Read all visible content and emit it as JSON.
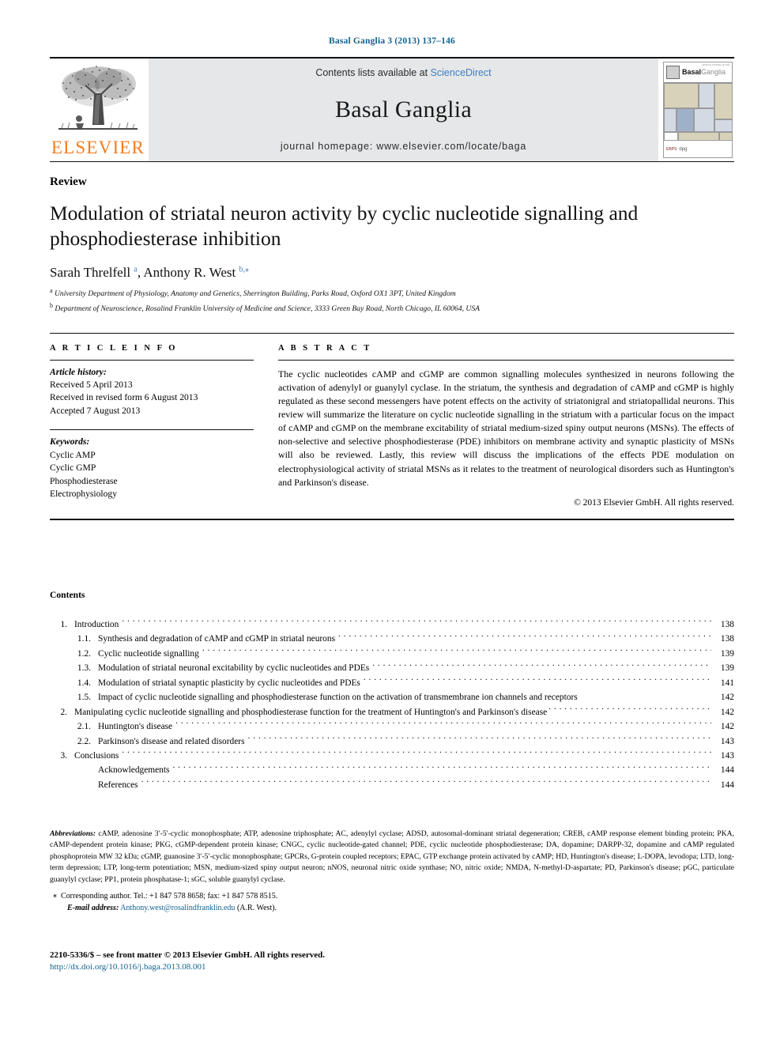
{
  "running_head": "Basal Ganglia 3 (2013) 137–146",
  "masthead": {
    "publisher_logo_word": "ELSEVIER",
    "contents_line_prefix": "Contents lists available at ",
    "sciencedirect": "ScienceDirect",
    "journal_name": "Basal Ganglia",
    "homepage": "journal homepage: www.elsevier.com/locate/baga",
    "cover": {
      "title_bold": "Basal",
      "title_light": "Ganglia",
      "micro_text": "OFFICIAL JOURNAL OF THE",
      "footer_left": "EBPS",
      "footer_right": "dpg"
    }
  },
  "article": {
    "doctype": "Review",
    "title": "Modulation of striatal neuron activity by cyclic nucleotide signalling and phosphodiesterase inhibition",
    "authors_html": "Sarah Threlfell <sup>a</sup>, Anthony R. West <sup>b,⁎</sup>",
    "affiliations": [
      "University Department of Physiology, Anatomy and Genetics, Sherrington Building, Parks Road, Oxford OX1 3PT, United Kingdom",
      "Department of Neuroscience, Rosalind Franklin University of Medicine and Science, 3333 Green Bay Road, North Chicago, IL 60064, USA"
    ],
    "affiliation_marks": [
      "a",
      "b"
    ]
  },
  "info": {
    "heading": "A R T I C L E   I N F O",
    "history_label": "Article history:",
    "history": [
      "Received 5 April 2013",
      "Received in revised form 6 August 2013",
      "Accepted 7 August 2013"
    ],
    "keywords_label": "Keywords:",
    "keywords": [
      "Cyclic AMP",
      "Cyclic GMP",
      "Phosphodiesterase",
      "Electrophysiology"
    ]
  },
  "abstract": {
    "heading": "A B S T R A C T",
    "text": "The cyclic nucleotides cAMP and cGMP are common signalling molecules synthesized in neurons following the activation of adenylyl or guanylyl cyclase. In the striatum, the synthesis and degradation of cAMP and cGMP is highly regulated as these second messengers have potent effects on the activity of striatonigral and striatopallidal neurons. This review will summarize the literature on cyclic nucleotide signalling in the striatum with a particular focus on the impact of cAMP and cGMP on the membrane excitability of striatal medium-sized spiny output neurons (MSNs). The effects of non-selective and selective phosphodiesterase (PDE) inhibitors on membrane activity and synaptic plasticity of MSNs will also be reviewed. Lastly, this review will discuss the implications of the effects PDE modulation on electrophysiological activity of striatal MSNs as it relates to the treatment of neurological disorders such as Huntington's and Parkinson's disease.",
    "copyright": "© 2013 Elsevier GmbH. All rights reserved."
  },
  "contents": {
    "heading": "Contents",
    "entries": [
      {
        "num": "1.",
        "level": 1,
        "label": "Introduction",
        "page": "138"
      },
      {
        "num": "1.1.",
        "level": 2,
        "label": "Synthesis and degradation of cAMP and cGMP in striatal neurons",
        "page": "138"
      },
      {
        "num": "1.2.",
        "level": 2,
        "label": "Cyclic nucleotide signalling",
        "page": "139"
      },
      {
        "num": "1.3.",
        "level": 2,
        "label": "Modulation of striatal neuronal excitability by cyclic nucleotides and PDEs",
        "page": "139"
      },
      {
        "num": "1.4.",
        "level": 2,
        "label": "Modulation of striatal synaptic plasticity by cyclic nucleotides and PDEs",
        "page": "141"
      },
      {
        "num": "1.5.",
        "level": 2,
        "label": "Impact of cyclic nucleotide signalling and phosphodiesterase function on the activation of transmembrane ion channels and receptors",
        "page": "142",
        "nodots": true
      },
      {
        "num": "2.",
        "level": 1,
        "label": "Manipulating cyclic nucleotide signalling and phosphodiesterase function for the treatment of Huntington's and Parkinson's disease",
        "page": "142",
        "shortdots": true
      },
      {
        "num": "2.1.",
        "level": 2,
        "label": "Huntington's disease",
        "page": "142"
      },
      {
        "num": "2.2.",
        "level": 2,
        "label": "Parkinson's disease and related disorders",
        "page": "143"
      },
      {
        "num": "3.",
        "level": 1,
        "label": "Conclusions",
        "page": "143"
      },
      {
        "num": "",
        "level": 0,
        "label": "Acknowledgements",
        "page": "144"
      },
      {
        "num": "",
        "level": 0,
        "label": "References",
        "page": "144"
      }
    ]
  },
  "footnotes": {
    "abbrev_label": "Abbreviations:",
    "abbrev_text": "cAMP, adenosine 3′-5′-cyclic monophosphate; ATP, adenosine triphosphate; AC, adenylyl cyclase; ADSD, autosomal-dominant striatal degeneration; CREB, cAMP response element binding protein; PKA, cAMP-dependent protein kinase; PKG, cGMP-dependent protein kinase; CNGC, cyclic nucleotide-gated channel; PDE, cyclic nucleotide phosphodiesterase; DA, dopamine; DARPP-32, dopamine and cAMP regulated phosphoprotein MW 32 kDa; cGMP, guanosine 3′-5′-cyclic monophosphate; GPCRs, G-protein coupled receptors; EPAC, GTP exchange protein activated by cAMP; HD, Huntington's disease; L-DOPA, levodopa; LTD, long-term depression; LTP, long-term potentiation; MSN, medium-sized spiny output neuron; nNOS, neuronal nitric oxide synthase; NO, nitric oxide; NMDA, N-methyl-D-aspartate; PD, Parkinson's disease; pGC, particulate guanylyl cyclase; PP1, protein phosphatase-1; sGC, soluble guanylyl cyclase.",
    "corresponding": "Corresponding author. Tel.: +1 847 578 8658; fax: +1 847 578 8515.",
    "corresponding_mark": "⁎",
    "email_label": "E-mail address:",
    "email": "Anthony.west@rosalindfranklin.edu",
    "email_suffix": "(A.R. West)."
  },
  "bottom": {
    "issn_line": "2210-5336/$ – see front matter © 2013 Elsevier GmbH. All rights reserved.",
    "doi": "http://dx.doi.org/10.1016/j.baga.2013.08.001"
  },
  "colors": {
    "link_blue": "#11628f",
    "sciencedirect_blue": "#3c7fc4",
    "elsevier_orange": "#f47c20",
    "band_gray": "#e6e7e8"
  }
}
